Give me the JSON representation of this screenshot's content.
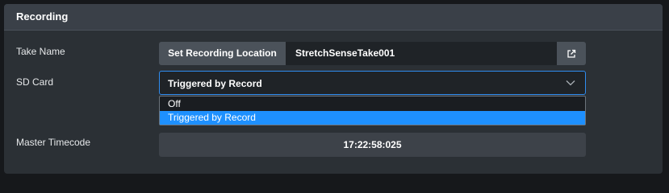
{
  "panel": {
    "title": "Recording"
  },
  "take_name": {
    "label": "Take Name",
    "location_button": "Set Recording Location",
    "value": "StretchSenseTake001"
  },
  "sd_card": {
    "label": "SD Card",
    "selected": "Triggered by Record",
    "options": [
      "Off",
      "Triggered by Record"
    ]
  },
  "master_timecode": {
    "label": "Master Timecode",
    "value": "17:22:58:025"
  },
  "colors": {
    "accent": "#1e90ff",
    "panel_bg": "#2b3035",
    "header_bg": "#3a4048"
  },
  "icons": {
    "open": "external-link-icon",
    "chevron": "chevron-down-icon"
  }
}
